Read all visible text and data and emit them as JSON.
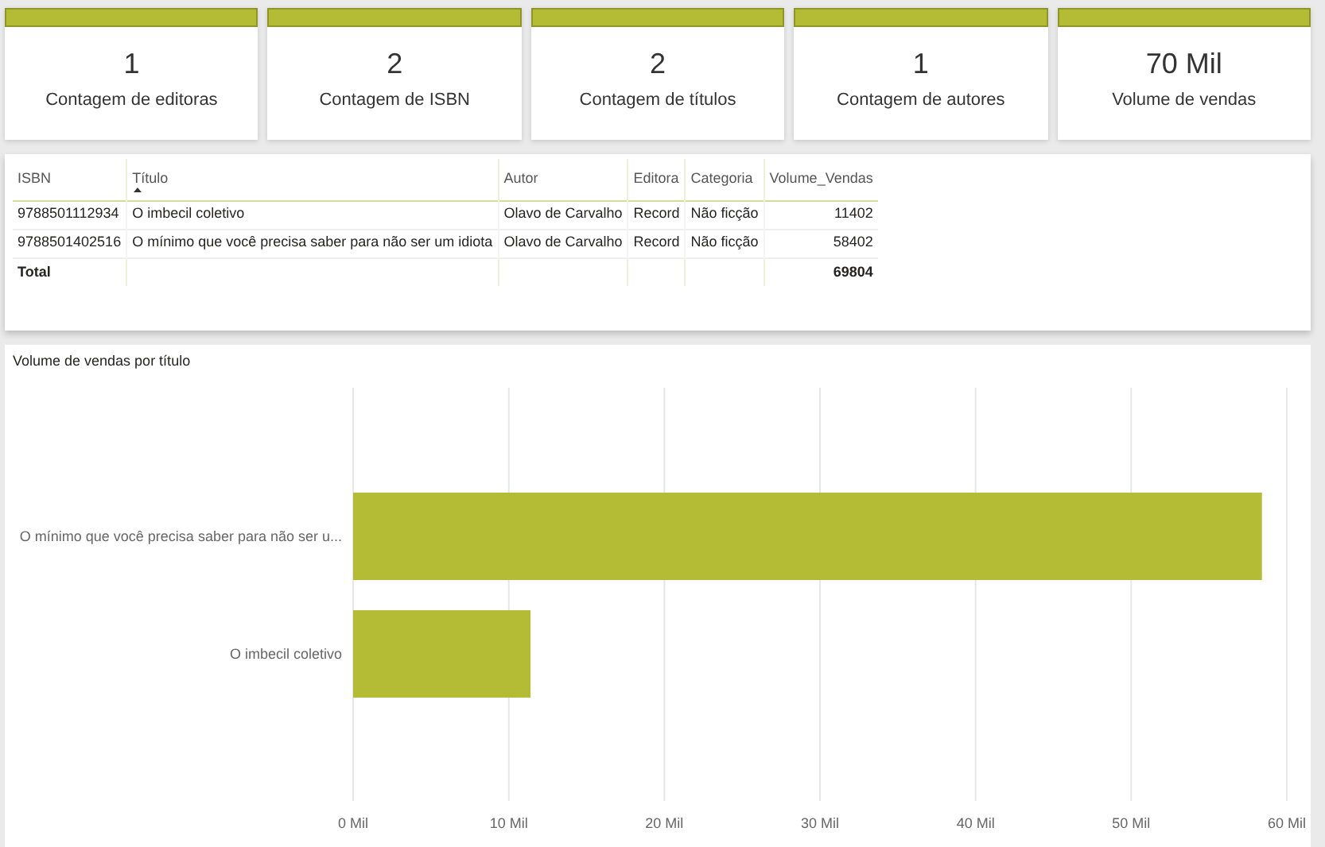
{
  "cards": [
    {
      "value": "1",
      "label": "Contagem de editoras"
    },
    {
      "value": "2",
      "label": "Contagem de ISBN"
    },
    {
      "value": "2",
      "label": "Contagem de títulos"
    },
    {
      "value": "1",
      "label": "Contagem de autores"
    },
    {
      "value": "70 Mil",
      "label": "Volume de vendas"
    }
  ],
  "table": {
    "columns": [
      {
        "label": "ISBN",
        "sorted": false
      },
      {
        "label": "Título",
        "sorted": true
      },
      {
        "label": "Autor",
        "sorted": false
      },
      {
        "label": "Editora",
        "sorted": false
      },
      {
        "label": "Categoria",
        "sorted": false
      },
      {
        "label": "Volume_Vendas",
        "sorted": false
      }
    ],
    "rows": [
      [
        "9788501112934",
        "O imbecil coletivo",
        "Olavo de Carvalho",
        "Record",
        "Não ficção",
        "11402"
      ],
      [
        "9788501402516",
        "O mínimo que você precisa saber para não ser um idiota",
        "Olavo de Carvalho",
        "Record",
        "Não ficção",
        "58402"
      ]
    ],
    "total": {
      "label": "Total",
      "value": "69804"
    }
  },
  "chart": {
    "chart_data": {
      "type": "bar",
      "orientation": "horizontal",
      "title": "Volume de vendas por título",
      "categories": [
        "O mínimo que você precisa saber para não ser u...",
        "O imbecil coletivo"
      ],
      "series": [
        {
          "color": "#b3bc34",
          "values": [
            58.4,
            11.4
          ]
        }
      ],
      "xlim": [
        0,
        60
      ],
      "grid": true,
      "xticks": [
        {
          "value": 0,
          "label": "0 Mil"
        },
        {
          "value": 10,
          "label": "10 Mil"
        },
        {
          "value": 20,
          "label": "20 Mil"
        },
        {
          "value": 30,
          "label": "30 Mil"
        },
        {
          "value": 40,
          "label": "40 Mil"
        },
        {
          "value": 50,
          "label": "50 Mil"
        },
        {
          "value": 60,
          "label": "60 Mil"
        }
      ]
    }
  }
}
